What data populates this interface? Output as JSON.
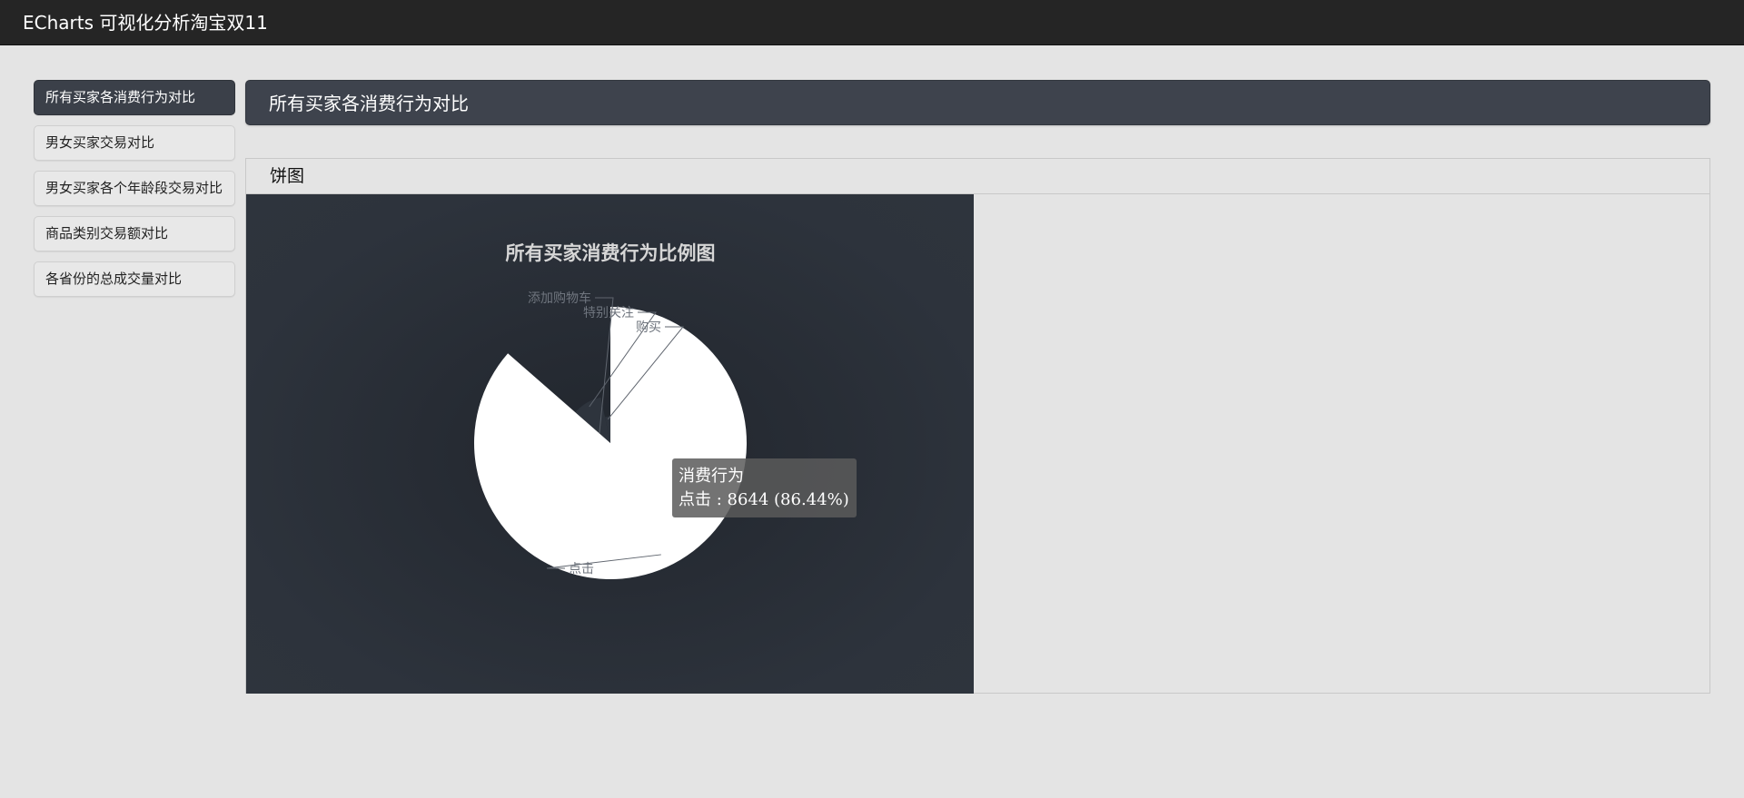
{
  "navbar": {
    "brand": "ECharts 可视化分析淘宝双11"
  },
  "sidebar": {
    "items": [
      {
        "label": "所有买家各消费行为对比",
        "active": true
      },
      {
        "label": "男女买家交易对比",
        "active": false
      },
      {
        "label": "男女买家各个年龄段交易对比",
        "active": false
      },
      {
        "label": "商品类别交易额对比",
        "active": false
      },
      {
        "label": "各省份的总成交量对比",
        "active": false
      }
    ]
  },
  "header": {
    "title": "所有买家各消费行为对比"
  },
  "card": {
    "title": "饼图"
  },
  "chart_data": {
    "type": "pie",
    "title": "所有买家消费行为比例图",
    "series_name": "消费行为",
    "categories": [
      "点击",
      "添加购物车",
      "特别关注",
      "购买"
    ],
    "values": [
      8644,
      12,
      1015,
      329
    ],
    "colors": [
      "#ffffff",
      "#c8c8c8",
      "#2e343d",
      "#2e343d"
    ],
    "label_color": "#6f757e",
    "tooltip": {
      "title": "消费行为",
      "text": "点击 : 8644 (86.44%)"
    }
  }
}
